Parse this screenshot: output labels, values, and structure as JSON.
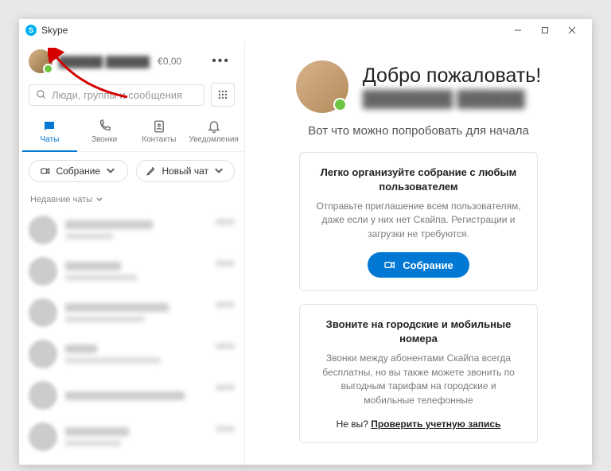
{
  "titlebar": {
    "title": "Skype"
  },
  "profile": {
    "name": "██████ ██████",
    "balance": "€0,00"
  },
  "search": {
    "placeholder": "Люди, группы и сообщения"
  },
  "tabs": {
    "chats": "Чаты",
    "calls": "Звонки",
    "contacts": "Контакты",
    "notifications": "Уведомления"
  },
  "actions": {
    "meeting": "Собрание",
    "newchat": "Новый чат"
  },
  "recent": {
    "label": "Недавние чаты"
  },
  "chats": [
    {
      "name_w": 110,
      "msg_w": 60
    },
    {
      "name_w": 70,
      "msg_w": 90
    },
    {
      "name_w": 130,
      "msg_w": 100
    },
    {
      "name_w": 40,
      "msg_w": 120
    },
    {
      "name_w": 150,
      "msg_w": 0
    },
    {
      "name_w": 80,
      "msg_w": 70
    }
  ],
  "main": {
    "welcome": "Добро пожаловать!",
    "username": "████████ ██████",
    "subtitle": "Вот что можно попробовать для начала",
    "card1": {
      "title": "Легко организуйте собрание с любым пользователем",
      "text": "Отправьте приглашение всем пользователям, даже если у них нет Скайпа. Регистрации и загрузки не требуются.",
      "button": "Собрание"
    },
    "card2": {
      "title": "Звоните на городские и мобильные номера",
      "text": "Звонки между абонентами Скайпа всегда бесплатны, но вы также можете звонить по выгодным тарифам на городские и мобильные телефонные",
      "foot_prefix": "Не вы? ",
      "foot_link": "Проверить учетную запись"
    }
  }
}
